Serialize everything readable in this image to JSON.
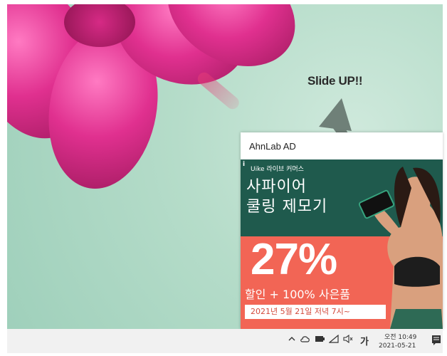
{
  "overlay": {
    "slide_text": "Slide UP!!"
  },
  "ad": {
    "header": "AhnLab AD",
    "info_icon": "i",
    "brand": "Uike 라이브 커머스",
    "product_line1": "사파이어",
    "product_line2": "쿨링 제모기",
    "discount": "27%",
    "promo": "할인 + 100% 사은품",
    "date_text": "2021년 5월 21일 저녁 7시~",
    "colors": {
      "banner_top": "#1f5a4d",
      "banner_bottom": "#f26555"
    }
  },
  "taskbar": {
    "tray_icons": [
      "chevron-up-icon",
      "cloud-icon",
      "battery-icon",
      "network-icon",
      "volume-mute-icon"
    ],
    "ime": "가",
    "time": "오전 10:49",
    "date": "2021-05-21"
  }
}
